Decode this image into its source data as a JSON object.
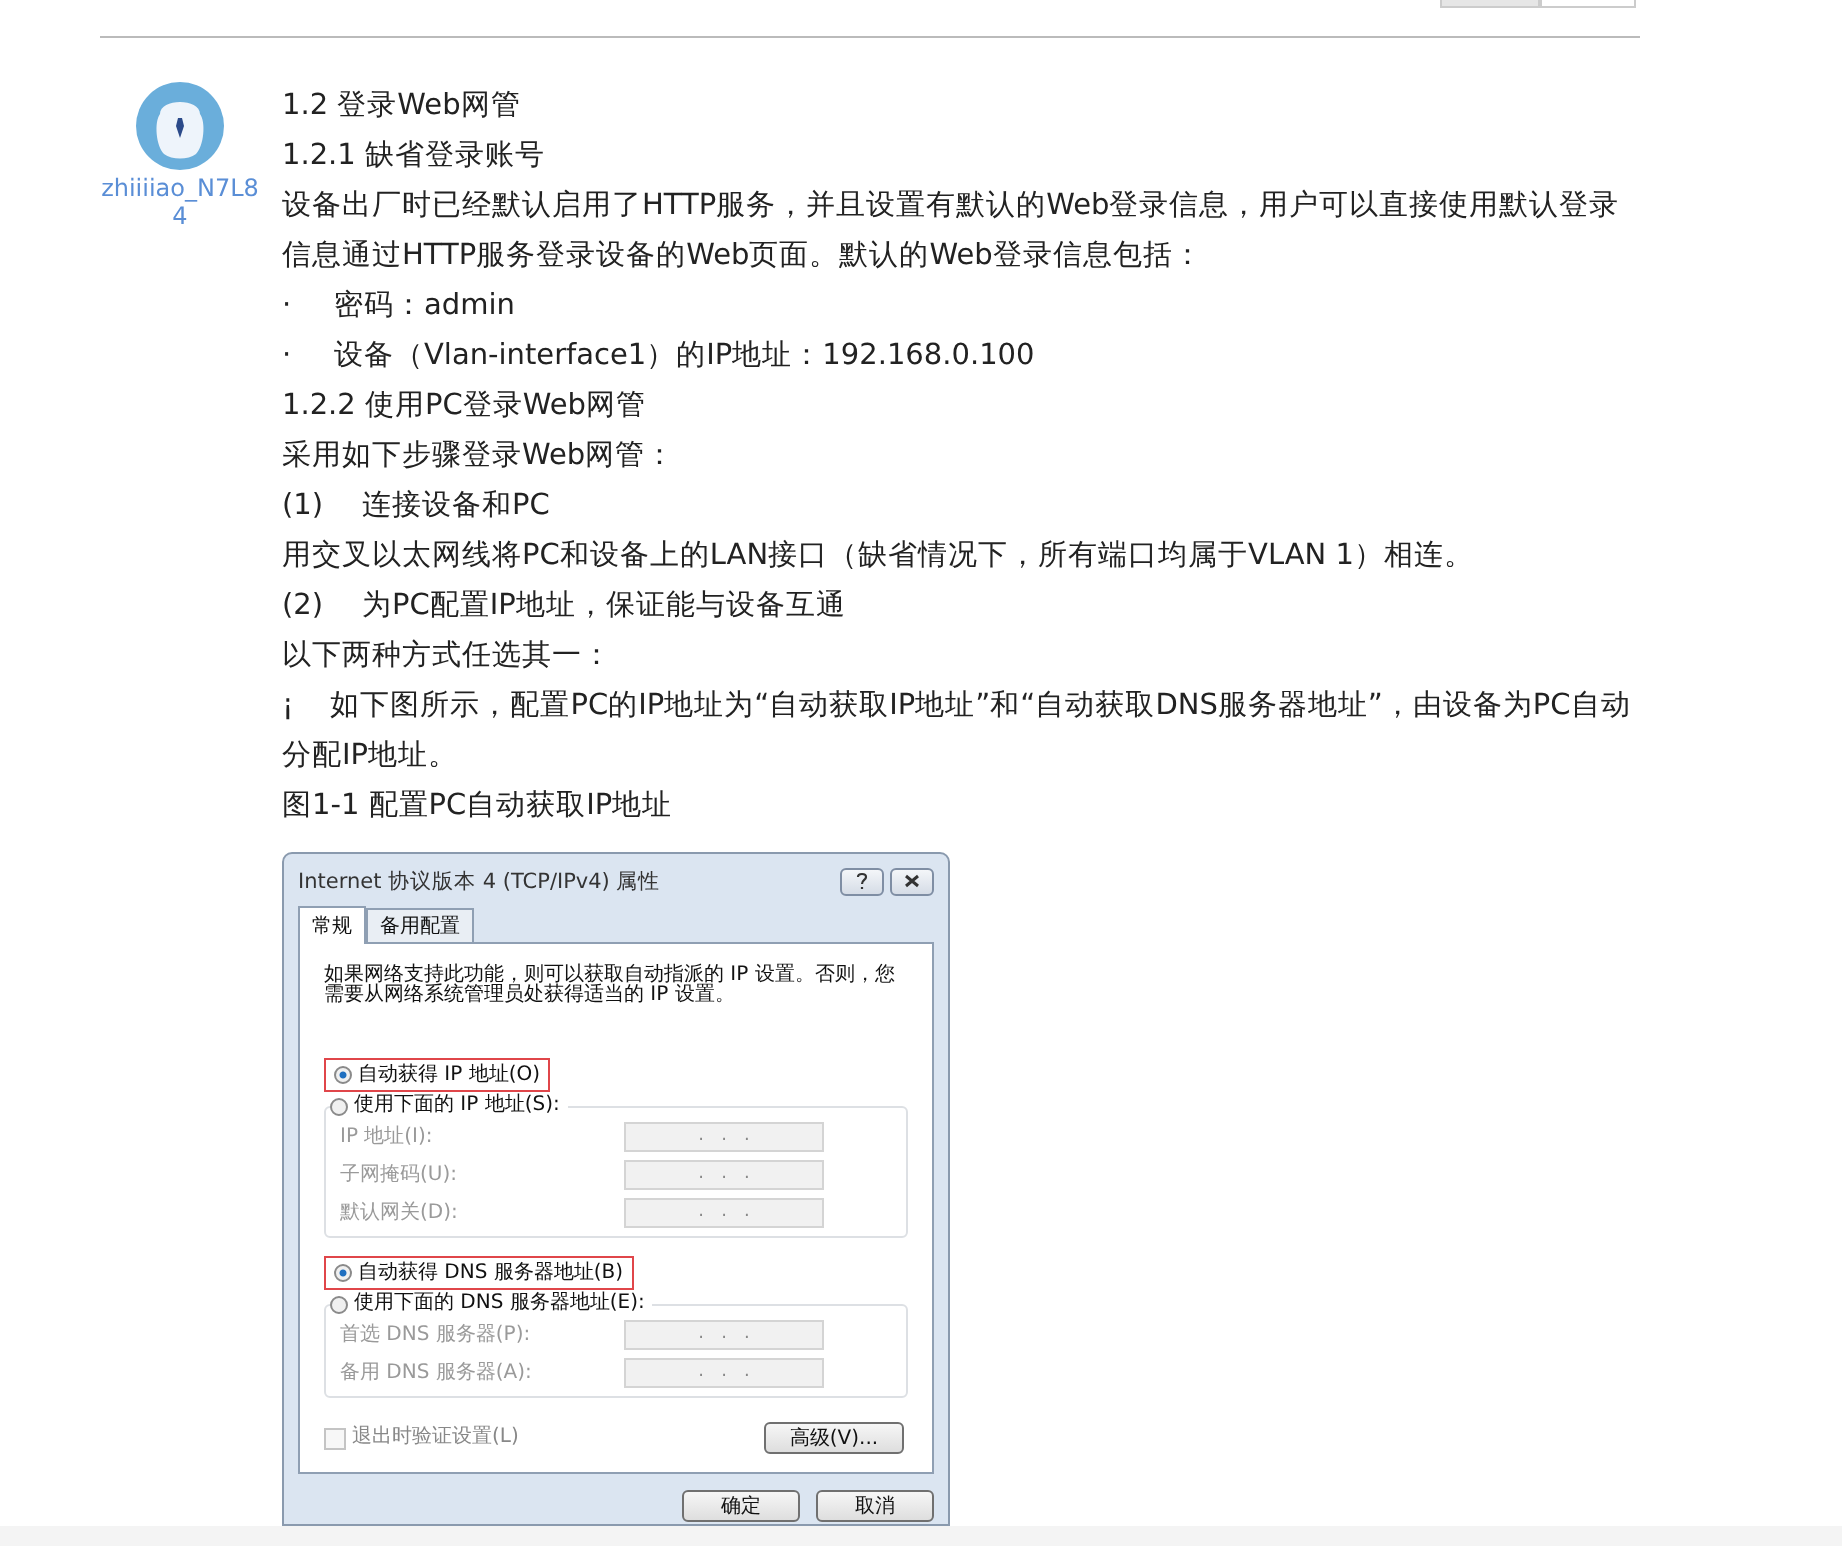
{
  "toolbar": [
    {
      "selected": true
    },
    {
      "selected": false
    }
  ],
  "author": {
    "name": "zhiiiiao_N7L84"
  },
  "article": [
    {
      "kind": "heading",
      "text": "1.2  登录Web网管"
    },
    {
      "kind": "heading",
      "text": "1.2.1  缺省登录账号"
    },
    {
      "kind": "paragraph",
      "text": "设备出厂时已经默认启用了HTTP服务，并且设置有默认的Web登录信息，用户可以直接使用默认登录信息通过HTTP服务登录设备的Web页面。默认的Web登录信息包括："
    },
    {
      "kind": "bullet",
      "marker": "·",
      "text": "密码：admin"
    },
    {
      "kind": "bullet",
      "marker": "·",
      "text": "设备（Vlan-interface1）的IP地址：192.168.0.100"
    },
    {
      "kind": "heading",
      "text": "1.2.2  使用PC登录Web网管"
    },
    {
      "kind": "paragraph",
      "text": "采用如下步骤登录Web网管："
    },
    {
      "kind": "step",
      "marker": "(1)",
      "text": "连接设备和PC"
    },
    {
      "kind": "paragraph",
      "text": "用交叉以太网线将PC和设备上的LAN接口（缺省情况下，所有端口均属于VLAN 1）相连。"
    },
    {
      "kind": "step",
      "marker": "(2)",
      "text": "为PC配置IP地址，保证能与设备互通"
    },
    {
      "kind": "paragraph",
      "text": "以下两种方式任选其一："
    },
    {
      "kind": "bullet",
      "marker": "¡",
      "text": "如下图所示，配置PC的IP地址为“自动获取IP地址”和“自动获取DNS服务器地址”，由设备为PC自动分配IP地址。"
    },
    {
      "kind": "caption",
      "text": "图1-1 配置PC自动获取IP地址"
    }
  ],
  "dialog": {
    "title": "Internet 协议版本 4 (TCP/IPv4) 属性",
    "tabs": [
      {
        "label": "常规",
        "selected": true
      },
      {
        "label": "备用配置",
        "selected": false
      }
    ],
    "description": "如果网络支持此功能，则可以获取自动指派的 IP 设置。否则，您需要从网络系统管理员处获得适当的 IP 设置。",
    "sections": [
      {
        "auto": {
          "label": "自动获得 IP 地址(O)",
          "selected": true,
          "highlighted": true
        },
        "manual": {
          "label": "使用下面的 IP 地址(S):",
          "selected": false
        },
        "fields": [
          {
            "label": "IP 地址(I):",
            "value": ".   .   ."
          },
          {
            "label": "子网掩码(U):",
            "value": ".   .   ."
          },
          {
            "label": "默认网关(D):",
            "value": ".   .   ."
          }
        ]
      },
      {
        "auto": {
          "label": "自动获得 DNS 服务器地址(B)",
          "selected": true,
          "highlighted": true
        },
        "manual": {
          "label": "使用下面的 DNS 服务器地址(E):",
          "selected": false
        },
        "fields": [
          {
            "label": "首选 DNS 服务器(P):",
            "value": ".   .   ."
          },
          {
            "label": "备用 DNS 服务器(A):",
            "value": ".   .   ."
          }
        ]
      }
    ],
    "validate": {
      "label": "退出时验证设置(L)",
      "checked": false,
      "disabled": true
    },
    "advanced": "高级(V)...",
    "buttons": [
      "确定",
      "取消"
    ]
  }
}
